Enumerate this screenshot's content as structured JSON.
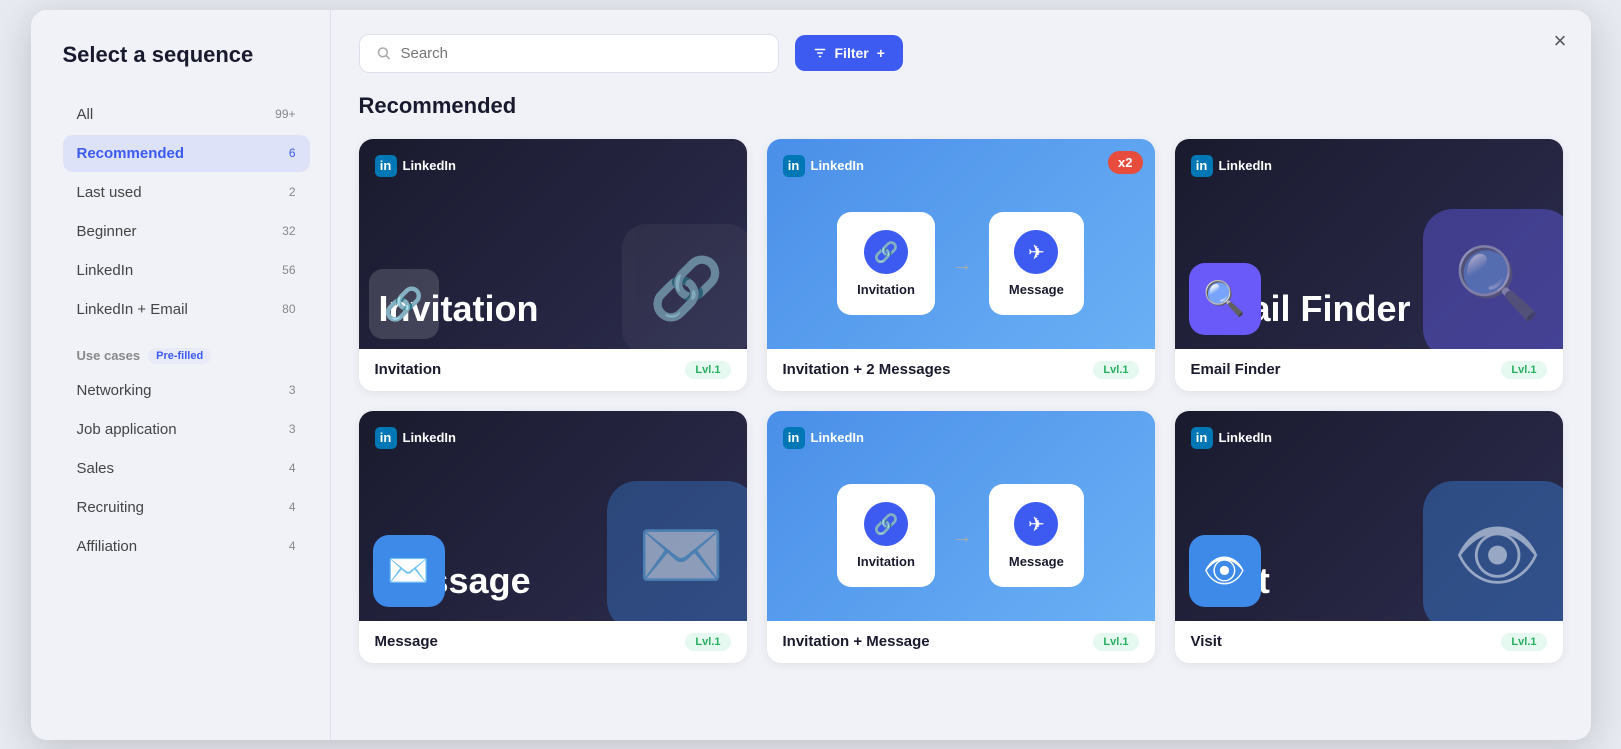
{
  "modal": {
    "title": "Select a sequence",
    "close_label": "×"
  },
  "search": {
    "placeholder": "Search"
  },
  "filter_btn": {
    "label": "Filter",
    "icon": "filter-icon",
    "plus": "+"
  },
  "sidebar": {
    "items": [
      {
        "id": "all",
        "label": "All",
        "count": "99+",
        "active": false
      },
      {
        "id": "recommended",
        "label": "Recommended",
        "count": "6",
        "active": true
      },
      {
        "id": "last-used",
        "label": "Last used",
        "count": "2",
        "active": false
      },
      {
        "id": "beginner",
        "label": "Beginner",
        "count": "32",
        "active": false
      },
      {
        "id": "linkedin",
        "label": "LinkedIn",
        "count": "56",
        "active": false
      },
      {
        "id": "linkedin-email",
        "label": "LinkedIn + Email",
        "count": "80",
        "active": false
      }
    ],
    "use_cases_label": "Use cases",
    "pre_filled_badge": "Pre-filled",
    "use_case_items": [
      {
        "id": "networking",
        "label": "Networking",
        "count": "3"
      },
      {
        "id": "job-application",
        "label": "Job application",
        "count": "3"
      },
      {
        "id": "sales",
        "label": "Sales",
        "count": "4"
      },
      {
        "id": "recruiting",
        "label": "Recruiting",
        "count": "4"
      },
      {
        "id": "affiliation",
        "label": "Affiliation",
        "count": "4"
      }
    ]
  },
  "main": {
    "section_title": "Recommended",
    "cards": [
      {
        "id": "invitation",
        "name": "Invitation",
        "level": "Lvl.1",
        "thumb_type": "dark",
        "big_text": "Invitation",
        "li_label": "LinkedIn",
        "icon_type": "chain"
      },
      {
        "id": "invitation-2-messages",
        "name": "Invitation + 2 Messages",
        "level": "Lvl.1",
        "thumb_type": "blue",
        "li_label": "LinkedIn",
        "icon_type": "flow",
        "x2": true
      },
      {
        "id": "email-finder",
        "name": "Email Finder",
        "level": "Lvl.1",
        "thumb_type": "dark",
        "big_text": "Email Finder",
        "li_label": "LinkedIn",
        "icon_type": "search"
      },
      {
        "id": "message",
        "name": "Message",
        "level": "Lvl.1",
        "thumb_type": "dark",
        "big_text": "Message",
        "li_label": "LinkedIn",
        "icon_type": "paper"
      },
      {
        "id": "invitation-message",
        "name": "Invitation + Message",
        "level": "Lvl.1",
        "thumb_type": "blue",
        "li_label": "LinkedIn",
        "icon_type": "flow",
        "x2": false
      },
      {
        "id": "visit",
        "name": "Visit",
        "level": "Lvl.1",
        "thumb_type": "dark",
        "big_text": "Visit",
        "li_label": "LinkedIn",
        "icon_type": "eye"
      }
    ],
    "flow_invitation_label": "Invitation",
    "flow_message_label": "Message"
  }
}
